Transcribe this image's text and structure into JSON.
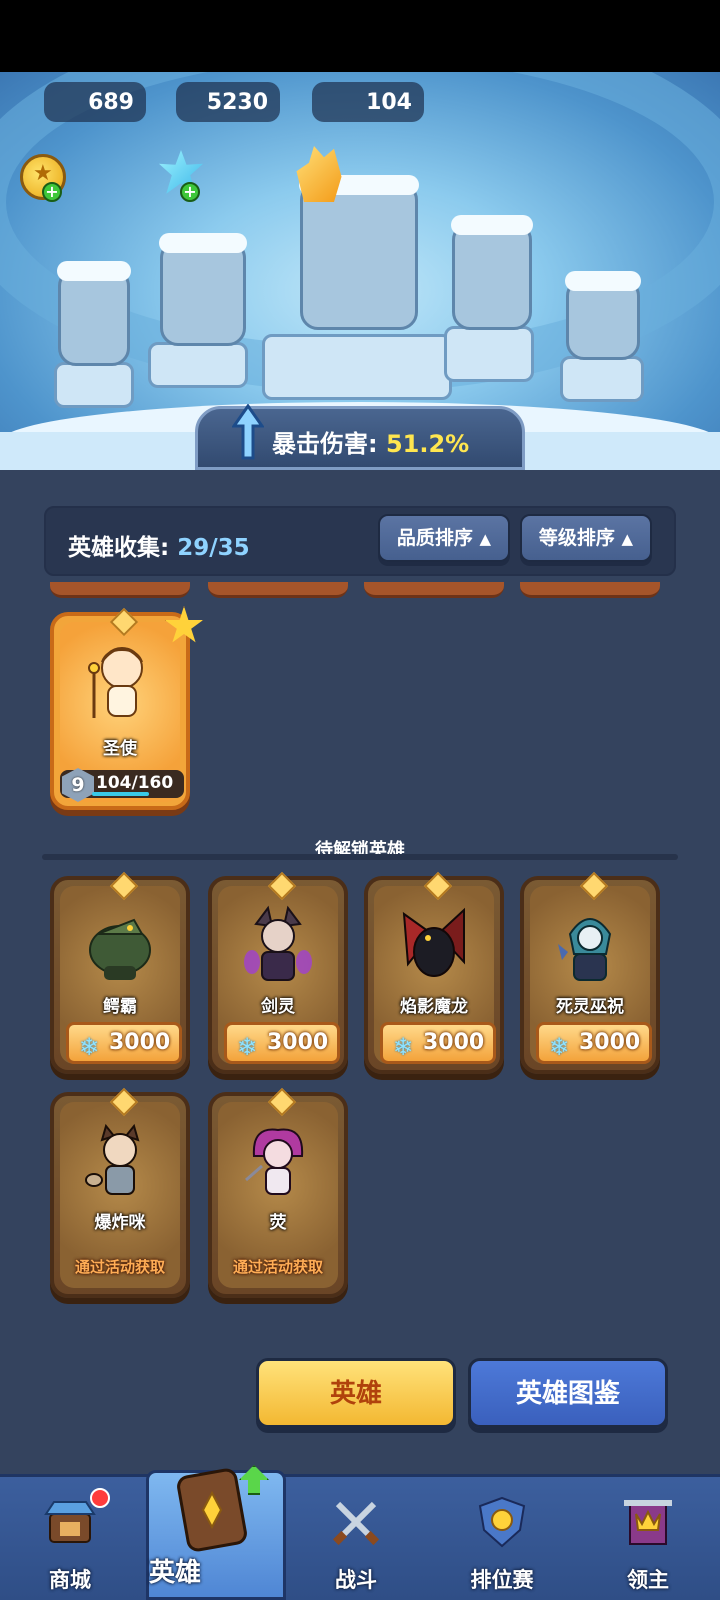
{
  "currencies": {
    "gold": "689",
    "crystal": "5230",
    "gem": "104"
  },
  "bonus": {
    "label": "暴击伤害: ",
    "value": "51.2%"
  },
  "collection": {
    "label": "英雄收集: ",
    "count": "29/35",
    "sort_quality": "品质排序",
    "sort_level": "等级排序",
    "sort_arrow": "▲"
  },
  "owned_heroes": [
    {
      "name": "圣使",
      "level": "9",
      "progress": "104/160",
      "progress_fraction": 0.65
    }
  ],
  "locked_section_title": "待解锁英雄",
  "locked_heroes": [
    {
      "name": "鳄霸",
      "price": "3000"
    },
    {
      "name": "剑灵",
      "price": "3000"
    },
    {
      "name": "焰影魔龙",
      "price": "3000"
    },
    {
      "name": "死灵巫祝",
      "price": "3000"
    },
    {
      "name": "爆炸咪",
      "event": "通过活动获取"
    },
    {
      "name": "荧",
      "event": "通过活动获取"
    }
  ],
  "buttons": {
    "heroes": "英雄",
    "codex": "英雄图鉴"
  },
  "nav": {
    "shop": "商城",
    "heroes": "英雄",
    "battle": "战斗",
    "ranked": "排位赛",
    "lord": "领主"
  },
  "colors": {
    "accent_yellow": "#ffe64f",
    "panel_bg": "#34435e",
    "nav_bg": "#3c5f9e"
  }
}
